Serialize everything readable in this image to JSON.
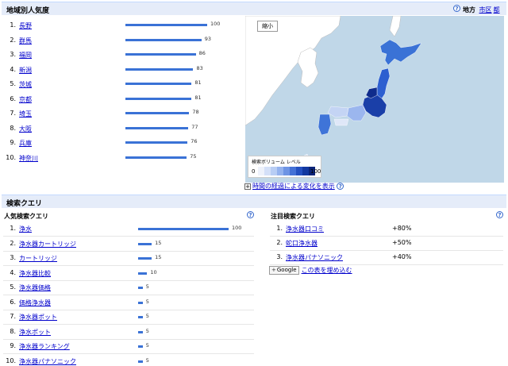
{
  "region_section": {
    "title": "地域別人気度",
    "region_label": "地方",
    "city_label": "市区",
    "prefecture_label": "都",
    "scale_max": 100,
    "items": [
      {
        "rank": "1.",
        "name": "長野",
        "value": 100
      },
      {
        "rank": "2.",
        "name": "群馬",
        "value": 93
      },
      {
        "rank": "3.",
        "name": "福岡",
        "value": 86
      },
      {
        "rank": "4.",
        "name": "新潟",
        "value": 83
      },
      {
        "rank": "5.",
        "name": "茨城",
        "value": 81
      },
      {
        "rank": "6.",
        "name": "京都",
        "value": 81
      },
      {
        "rank": "7.",
        "name": "埼玉",
        "value": 78
      },
      {
        "rank": "8.",
        "name": "大阪",
        "value": 77
      },
      {
        "rank": "9.",
        "name": "兵庫",
        "value": 76
      },
      {
        "rank": "10.",
        "name": "神奈川",
        "value": 75
      }
    ]
  },
  "map": {
    "zoom_label": "縮小",
    "legend_title": "検索ボリューム レベル",
    "legend_min": "0",
    "legend_max": "100",
    "legend_colors": [
      "#eef2fb",
      "#d4e0f8",
      "#b8cdf4",
      "#94b2ee",
      "#6e94e4",
      "#4471d6",
      "#2450c0",
      "#1238a0",
      "#0a2478"
    ],
    "sea_color": "#c0d7e8",
    "land_color": "#ffffff"
  },
  "time_link": "時間の経過による変化を表示",
  "query_section": {
    "title": "検索クエリ",
    "popular": {
      "title": "人気検索クエリ",
      "scale_max": 100,
      "items": [
        {
          "rank": "1.",
          "name": "浄水",
          "value": 100
        },
        {
          "rank": "2.",
          "name": "浄水器カートリッジ",
          "value": 15
        },
        {
          "rank": "3.",
          "name": "カートリッジ",
          "value": 15
        },
        {
          "rank": "4.",
          "name": "浄水器比較",
          "value": 10
        },
        {
          "rank": "5.",
          "name": "浄水器価格",
          "value": 5
        },
        {
          "rank": "6.",
          "name": "価格浄水器",
          "value": 5
        },
        {
          "rank": "7.",
          "name": "浄水器ポット",
          "value": 5
        },
        {
          "rank": "8.",
          "name": "浄水ポット",
          "value": 5
        },
        {
          "rank": "9.",
          "name": "浄水器ランキング",
          "value": 5
        },
        {
          "rank": "10.",
          "name": "浄水器パナソニック",
          "value": 5
        }
      ]
    },
    "rising": {
      "title": "注目検索クエリ",
      "items": [
        {
          "rank": "1.",
          "name": "浄水器口コミ",
          "change": "+80%"
        },
        {
          "rank": "2.",
          "name": "蛇口浄水器",
          "change": "+50%"
        },
        {
          "rank": "3.",
          "name": "浄水器パナソニック",
          "change": "+40%"
        }
      ]
    },
    "google_button": "Google",
    "embed_link": "この表を埋め込む"
  },
  "accent_color": "#3a72d6",
  "header_bg_color": "#e5ecf9"
}
